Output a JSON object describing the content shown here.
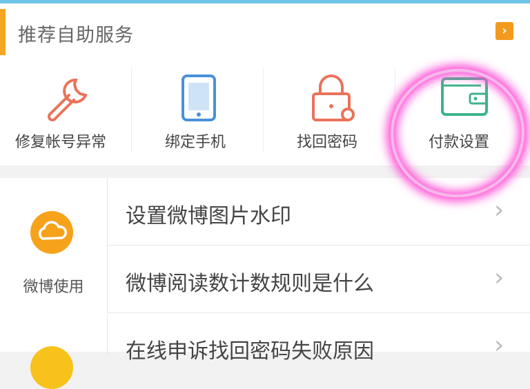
{
  "header": {
    "title": "推荐自助服务",
    "more_glyph": "›"
  },
  "services": [
    {
      "label": "修复帐号异常",
      "icon": "wrench-icon",
      "color": "#e9735a"
    },
    {
      "label": "绑定手机",
      "icon": "phone-icon",
      "color": "#4a90d9"
    },
    {
      "label": "找回密码",
      "icon": "lock-icon",
      "color": "#e9735a"
    },
    {
      "label": "付款设置",
      "icon": "wallet-icon",
      "color": "#3db48a"
    }
  ],
  "list": {
    "category": {
      "label": "微博使用",
      "icon": "cloud-icon",
      "color": "#f7a21b"
    },
    "rows": [
      {
        "text": "设置微博图片水印"
      },
      {
        "text": "微博阅读数计数规则是什么"
      },
      {
        "text": "在线申诉找回密码失败原因"
      }
    ],
    "chevron": "›"
  }
}
